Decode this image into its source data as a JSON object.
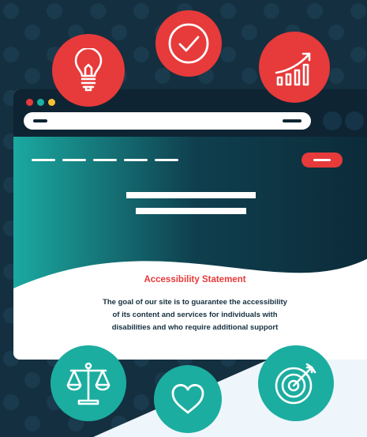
{
  "window": {
    "traffic_lights": [
      "red",
      "teal",
      "yellow"
    ],
    "address_bar": ""
  },
  "statement": {
    "title": "Accessibility Statement",
    "body_lines": [
      "The goal of our site is to guarantee the accessibility",
      "of its content and services for individuals with",
      "disabilities and who require additional support"
    ]
  },
  "icons": [
    "lightbulb-icon",
    "checkmark-icon",
    "growth-chart-icon",
    "scales-of-justice-icon",
    "heart-icon",
    "target-icon"
  ],
  "colors": {
    "background_navy": "#142f3f",
    "accent_red": "#e73a3a",
    "accent_teal": "#1bada0",
    "accent_yellow": "#f5c133",
    "panel_light": "#eef5fb"
  }
}
